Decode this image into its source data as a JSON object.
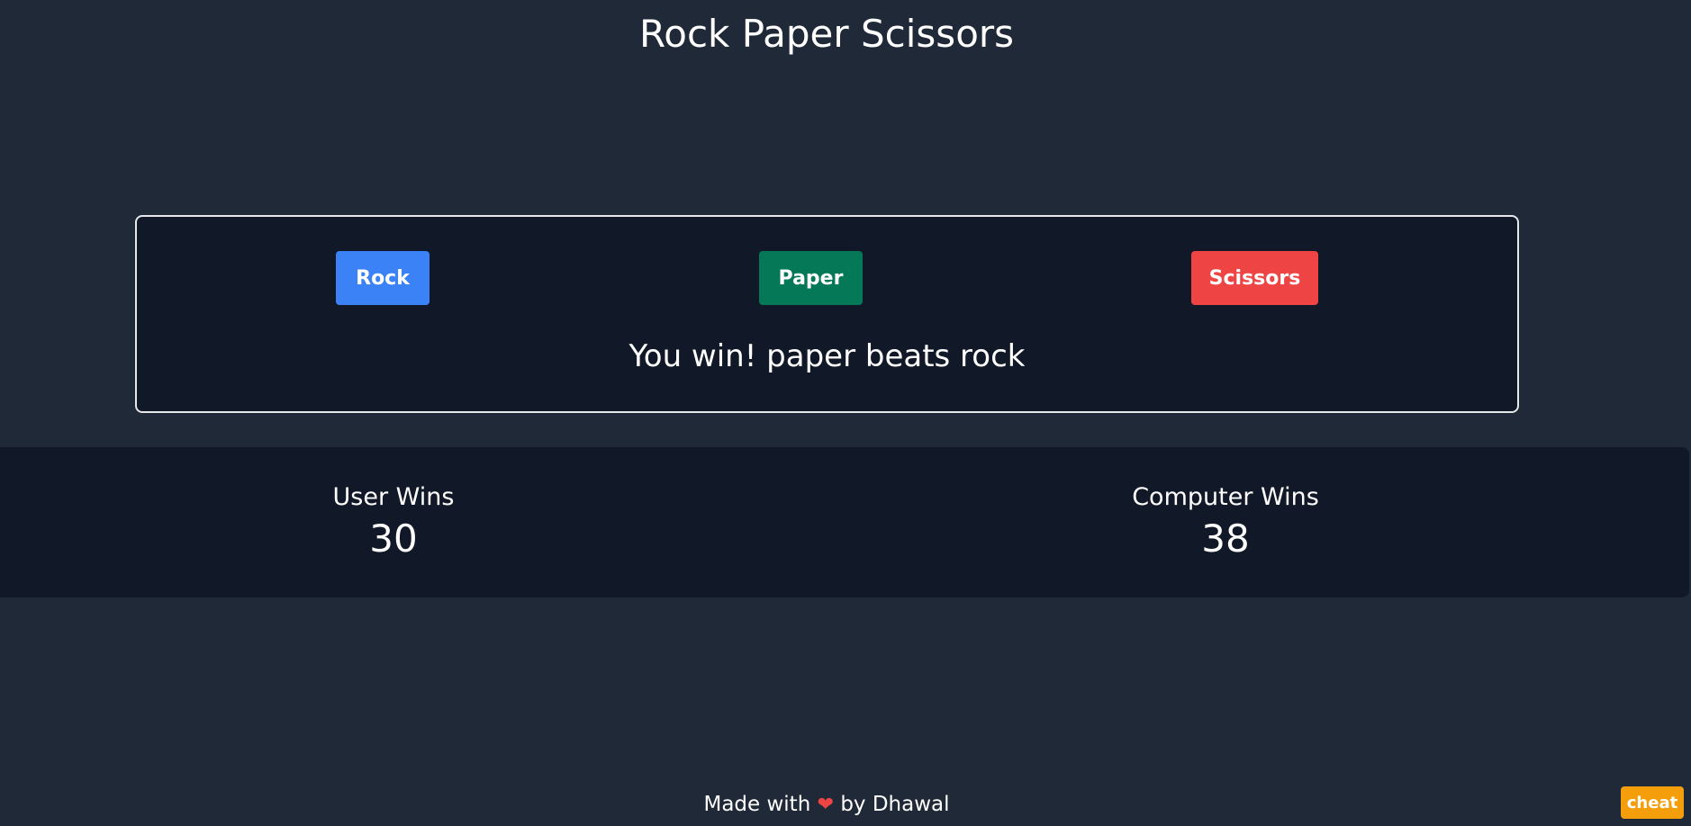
{
  "header": {
    "title": "Rock Paper Scissors"
  },
  "game": {
    "buttons": {
      "rock": "Rock",
      "paper": "Paper",
      "scissors": "Scissors"
    },
    "result": "You win! paper beats rock"
  },
  "scores": {
    "user_label": "User Wins",
    "user_value": "30",
    "computer_label": "Computer Wins",
    "computer_value": "38"
  },
  "footer": {
    "prefix": "Made with",
    "heart": "❤",
    "suffix": "by Dhawal"
  },
  "cheat": {
    "label": "cheat"
  },
  "colors": {
    "background": "#1f2937",
    "panel": "#111827",
    "rock": "#3b82f6",
    "paper": "#047857",
    "scissors": "#ef4444",
    "cheat": "#f59e0b"
  },
  "icons": {
    "heart": "heart-icon"
  }
}
